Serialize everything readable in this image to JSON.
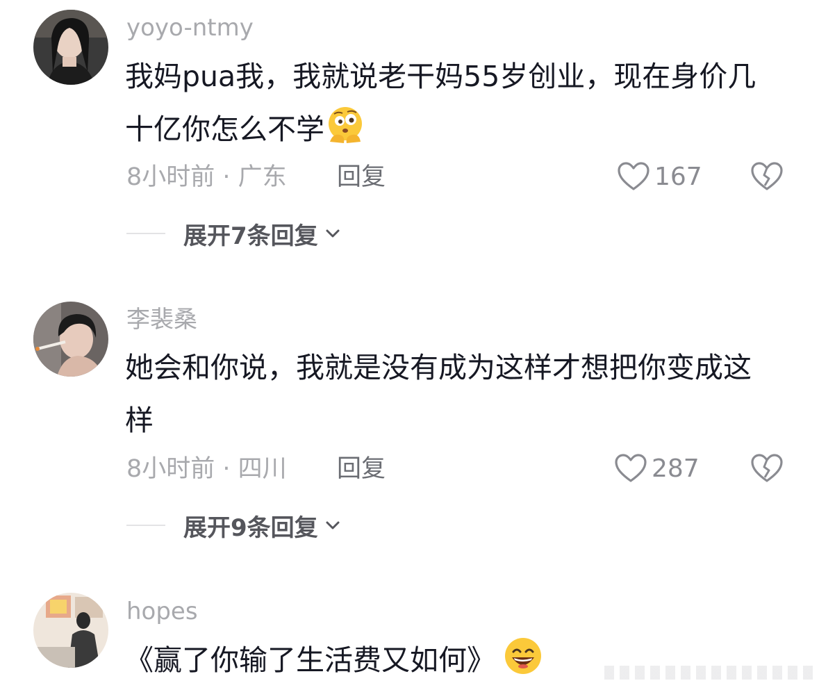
{
  "comments": [
    {
      "username": "yoyo-ntmy",
      "text": "我妈pua我，我就说老干妈55岁创业，现在身价几十亿你怎么不学",
      "emoji": "thinking-face-emoji",
      "meta": "8小时前 · 广东",
      "reply_label": "回复",
      "likes": "167",
      "expand_label": "展开7条回复"
    },
    {
      "username": "李裴桑",
      "text": "她会和你说，我就是没有成为这样才想把你变成这样",
      "meta": "8小时前 · 四川",
      "reply_label": "回复",
      "likes": "287",
      "expand_label": "展开9条回复"
    },
    {
      "username": "hopes",
      "text": "《赢了你输了生活费又如何》",
      "emoji": "grinning-face-emoji"
    }
  ],
  "colors": {
    "secondary_text": "#a8a9ad",
    "primary_text": "#161823",
    "icon": "#8a8b91"
  }
}
